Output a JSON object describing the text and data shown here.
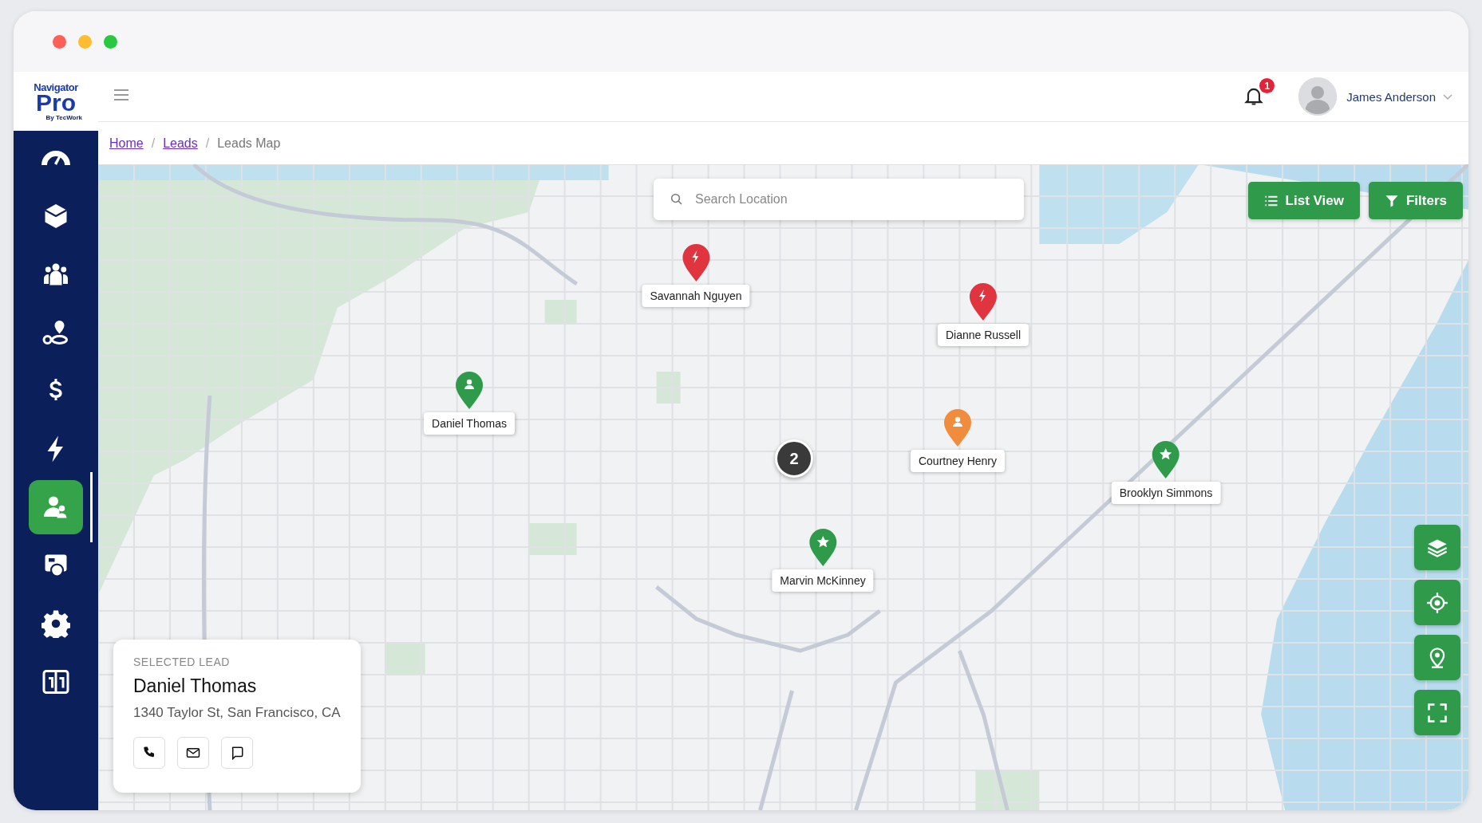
{
  "app": {
    "logo_top": "Navigator",
    "logo_main": "Pro",
    "logo_sub": "By TecWork"
  },
  "sidebar": {
    "items": [
      {
        "kind": "dashboard",
        "selected": false
      },
      {
        "kind": "box",
        "selected": false
      },
      {
        "kind": "team",
        "selected": false
      },
      {
        "kind": "route",
        "selected": false
      },
      {
        "kind": "dollar",
        "selected": false
      },
      {
        "kind": "bolt",
        "selected": false
      },
      {
        "kind": "leads",
        "selected": true
      },
      {
        "kind": "board",
        "selected": false
      },
      {
        "kind": "settings",
        "selected": false
      },
      {
        "kind": "book",
        "selected": false
      }
    ]
  },
  "header": {
    "notification_count": "1",
    "user_name": "James Anderson"
  },
  "breadcrumb": [
    {
      "label": "Home",
      "link": true
    },
    {
      "separator": "/",
      "label": "Leads",
      "link": true
    },
    {
      "separator": "/",
      "label": "Leads Map",
      "link": false
    }
  ],
  "search": {
    "placeholder": "Search Location"
  },
  "buttons": [
    {
      "label": "List View",
      "kind": "list"
    },
    {
      "label": "Filters",
      "kind": "filter"
    }
  ],
  "markers": [
    {
      "name": "Savannah Nguyen",
      "kind": "bolt",
      "color": "#e0343f"
    },
    {
      "name": "Dianne Russell",
      "kind": "bolt",
      "color": "#e0343f"
    },
    {
      "name": "Daniel Thomas",
      "kind": "person",
      "color": "#2e9a4a"
    },
    {
      "name": "Courtney Henry",
      "kind": "person",
      "color": "#f08c3c"
    },
    {
      "name": "Brooklyn Simmons",
      "kind": "star",
      "color": "#2e9a4a"
    },
    {
      "name": "Marvin McKinney",
      "kind": "star",
      "color": "#2e9a4a"
    }
  ],
  "cluster": {
    "count": "2"
  },
  "map_tools": [
    {
      "kind": "layers"
    },
    {
      "kind": "locate"
    },
    {
      "kind": "pin"
    },
    {
      "kind": "fullscreen"
    }
  ],
  "selected_lead": {
    "heading": "SELECTED LEAD",
    "name": "Daniel Thomas",
    "address": "1340 Taylor St, San Francisco, CA",
    "actions": [
      {
        "kind": "phone"
      },
      {
        "kind": "email"
      },
      {
        "kind": "message"
      }
    ]
  }
}
